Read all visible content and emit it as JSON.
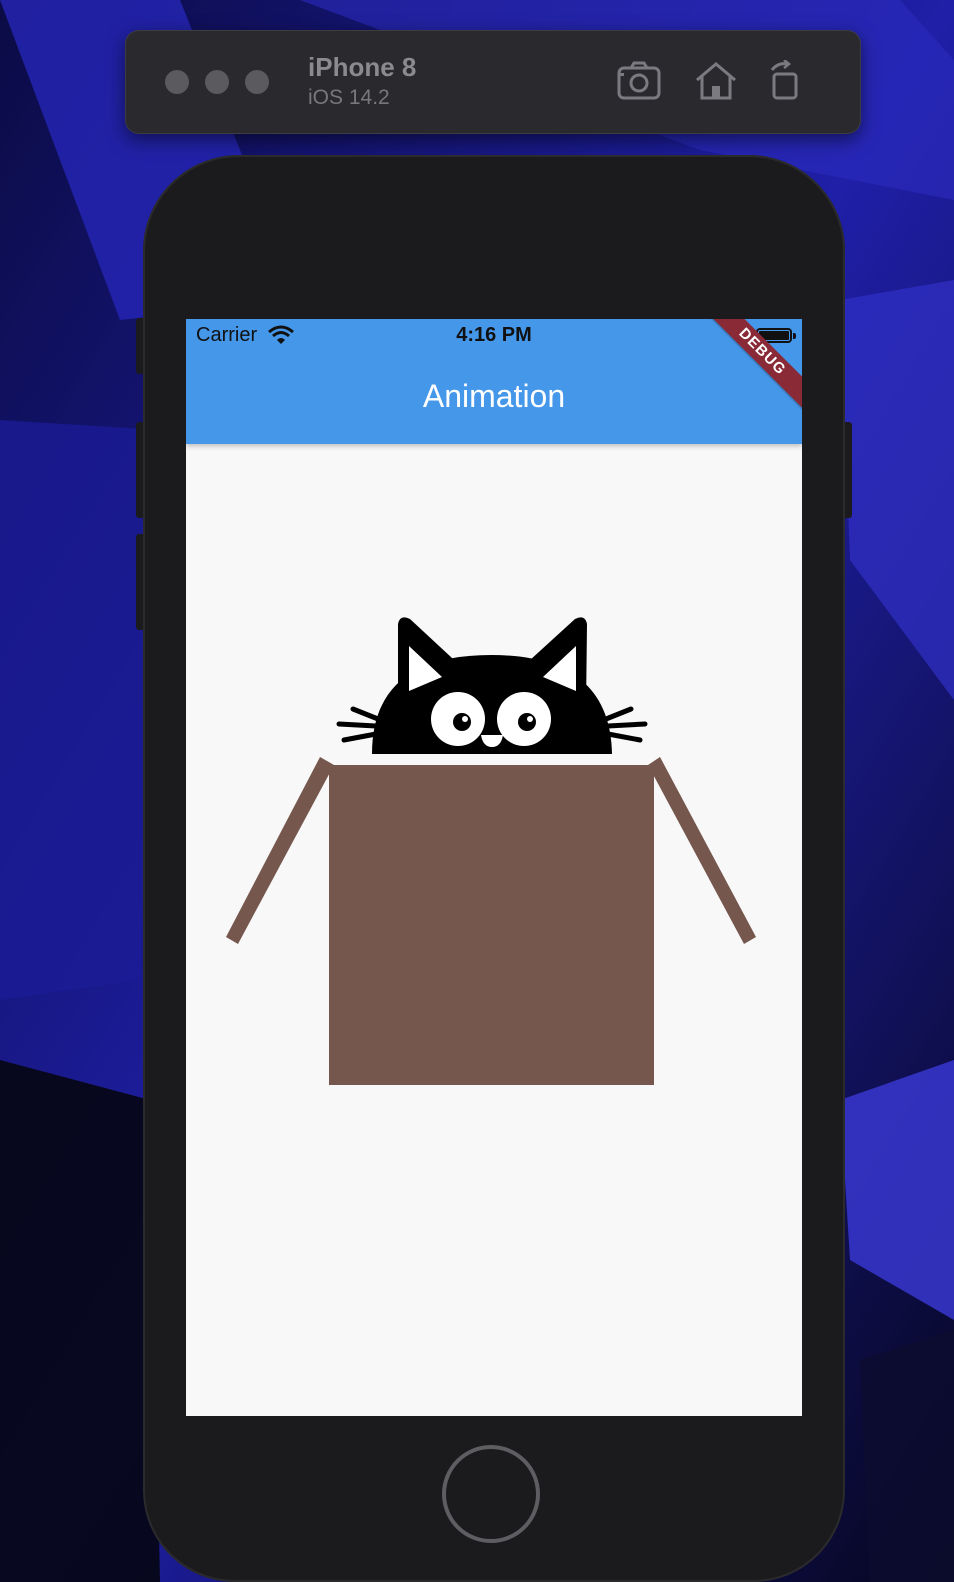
{
  "simulator": {
    "device_name": "iPhone 8",
    "os_version": "iOS 14.2",
    "toolbar": [
      "screenshot-icon",
      "home-icon",
      "rotate-icon"
    ]
  },
  "status_bar": {
    "carrier": "Carrier",
    "time": "4:16 PM"
  },
  "app_bar": {
    "title": "Animation",
    "debug_banner": "DEBUG",
    "color": "#4597ea"
  },
  "scene": {
    "box_color": "#75574d",
    "cat_color": "#000000",
    "background": "#f8f8f8"
  }
}
